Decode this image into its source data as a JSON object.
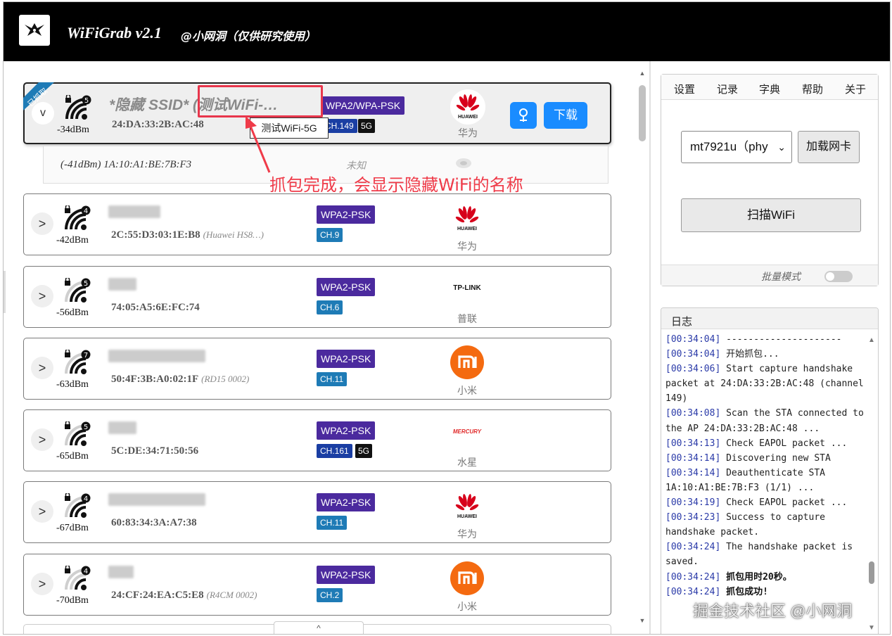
{
  "header": {
    "app_title": "WiFiGrab v2.1",
    "subtitle": "@小网洞（仅供研究使用）"
  },
  "colors": {
    "header_bg": "#000000",
    "enc_badge": "#4b2a9e",
    "channel_badge": "#1e7bb6",
    "primary_button": "#1a8cff",
    "annotation": "#ef3b49",
    "log_timestamp": "#2a3aa8"
  },
  "networks": [
    {
      "expand": "v",
      "captured_ribbon": "已抓取",
      "security_count": "5",
      "signal_bars": 4,
      "rssi": "-34dBm",
      "ssid": "*隐藏 SSID* (测试WiFi-…",
      "mac": "24:DA:33:2B:AC:48",
      "encryption": "WPA2/WPA-PSK",
      "channel": "CH.149",
      "band": "5G",
      "brand_logo": "huawei-logo",
      "brand": "华为",
      "pin_button": "pin-icon",
      "download_label": "下载",
      "tooltip": "测试WiFi-5G",
      "client": {
        "text": "(-41dBm) 1A:10:A1:BE:7B:F3",
        "vendor": "未知"
      }
    },
    {
      "expand": ">",
      "security_count": "4",
      "signal_bars": 4,
      "rssi": "-42dBm",
      "mac": "2C:55:D3:03:1E:B8",
      "vendor_note": "(Huawei HS8…)",
      "encryption": "WPA2-PSK",
      "channel": "CH.9",
      "brand_logo": "huawei-logo",
      "brand": "华为"
    },
    {
      "expand": ">",
      "security_count": "5",
      "signal_bars": 3,
      "rssi": "-56dBm",
      "mac": "74:05:A5:6E:FC:74",
      "encryption": "WPA2-PSK",
      "channel": "CH.6",
      "brand_logo": "tp-link-logo",
      "brand_logo_text": "TP-LINK",
      "brand": "普联"
    },
    {
      "expand": ">",
      "security_count": "7",
      "signal_bars": 3,
      "rssi": "-63dBm",
      "mac": "50:4F:3B:A0:02:1F",
      "vendor_note": "(RD15 0002)",
      "encryption": "WPA2-PSK",
      "channel": "CH.11",
      "brand_logo": "xiaomi-logo",
      "brand": "小米"
    },
    {
      "expand": ">",
      "security_count": "5",
      "signal_bars": 3,
      "rssi": "-65dBm",
      "mac": "5C:DE:34:71:50:56",
      "encryption": "WPA2-PSK",
      "channel": "CH.161",
      "band": "5G",
      "brand_logo": "mercury-logo",
      "brand_logo_text": "MERCURY",
      "brand": "水星"
    },
    {
      "expand": ">",
      "security_count": "4",
      "signal_bars": 3,
      "rssi": "-67dBm",
      "mac": "60:83:34:3A:A7:38",
      "encryption": "WPA2-PSK",
      "channel": "CH.11",
      "brand_logo": "huawei-logo",
      "brand": "华为"
    },
    {
      "expand": ">",
      "security_count": "4",
      "signal_bars": 2,
      "rssi": "-70dBm",
      "mac": "24:CF:24:EA:C5:E8",
      "vendor_note": "(R4CM 0002)",
      "encryption": "WPA2-PSK",
      "channel": "CH.2",
      "brand_logo": "xiaomi-logo",
      "brand": "小米"
    }
  ],
  "annotation": "抓包完成，会显示隐藏WiFi的名称",
  "scroll_top_label": "^",
  "control_panel": {
    "menu": [
      "设置",
      "记录",
      "字典",
      "帮助",
      "关于"
    ],
    "adapter_select": "mt7921u（phy",
    "load_adapter_button": "加载网卡",
    "scan_button": "扫描WiFi",
    "batch_mode_label": "批量模式",
    "batch_mode_on": false
  },
  "log": {
    "title": "日志",
    "lines": [
      {
        "ts": "[00:34:04]",
        "text": " ---------------------"
      },
      {
        "ts": "[00:34:04]",
        "text": " 开始抓包..."
      },
      {
        "ts": "[00:34:06]",
        "text": " Start capture handshake packet at 24:DA:33:2B:AC:48 (channel 149)"
      },
      {
        "ts": "[00:34:08]",
        "text": " Scan the STA connected to the AP 24:DA:33:2B:AC:48 ..."
      },
      {
        "ts": "[00:34:13]",
        "text": " Check EAPOL packet ..."
      },
      {
        "ts": "[00:34:14]",
        "text": " Discovering new STA"
      },
      {
        "ts": "[00:34:14]",
        "text": " Deauthenticate STA 1A:10:A1:BE:7B:F3 (1/1) ..."
      },
      {
        "ts": "[00:34:19]",
        "text": " Check EAPOL packet ..."
      },
      {
        "ts": "[00:34:23]",
        "text": " Success to capture handshake packet."
      },
      {
        "ts": "[00:34:24]",
        "text": " The handshake packet is saved."
      },
      {
        "ts": "[00:34:24]",
        "text": " 抓包用时20秒。",
        "bold": true
      },
      {
        "ts": "[00:34:24]",
        "text": " 抓包成功!",
        "bold": true
      }
    ]
  },
  "watermark": "掘金技术社区 @小网洞"
}
